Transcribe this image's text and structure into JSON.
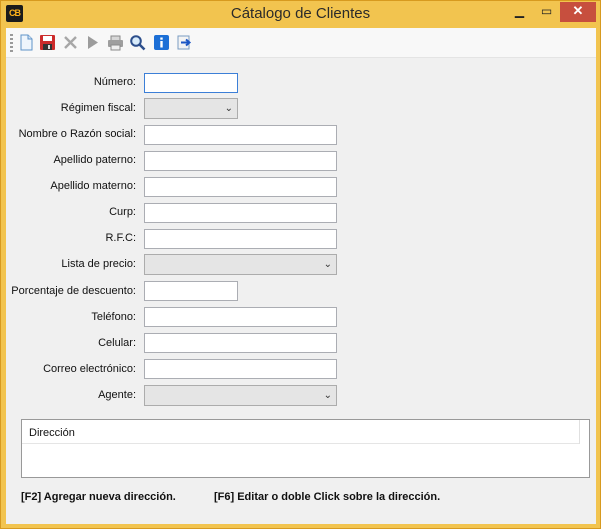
{
  "window": {
    "app_icon_text": "CB",
    "title": "Cátalogo de Clientes",
    "minimize": "▁",
    "maximize": "▭",
    "close": "✕"
  },
  "toolbar": {
    "items": [
      "new-document-icon",
      "save-icon",
      "delete-icon",
      "play-icon",
      "print-icon",
      "search-icon",
      "info-icon",
      "exit-icon"
    ]
  },
  "form": {
    "numero_label": "Número:",
    "regimen_label": "Régimen fiscal:",
    "nombre_label": "Nombre o Razón social:",
    "apellido_paterno_label": "Apellido paterno:",
    "apellido_materno_label": "Apellido materno:",
    "curp_label": "Curp:",
    "rfc_label": "R.F.C:",
    "lista_precio_label": "Lista de precio:",
    "descuento_label": "Porcentaje de descuento:",
    "telefono_label": "Teléfono:",
    "celular_label": "Celular:",
    "correo_label": "Correo electrónico:",
    "agente_label": "Agente:",
    "numero_value": "",
    "nombre_value": "",
    "apellido_paterno_value": "",
    "apellido_materno_value": "",
    "curp_value": "",
    "rfc_value": "",
    "descuento_value": "",
    "telefono_value": "",
    "celular_value": "",
    "correo_value": "",
    "combo_arrow": "⌄"
  },
  "address": {
    "column_header": "Dirección"
  },
  "hints": {
    "add": "[F2] Agregar nueva dirección.",
    "edit": "[F6] Editar o doble Click sobre la dirección."
  },
  "colors": {
    "titlebar": "#f2c44f",
    "close_button": "#c74f3e",
    "focus_border": "#3c7fd7"
  }
}
